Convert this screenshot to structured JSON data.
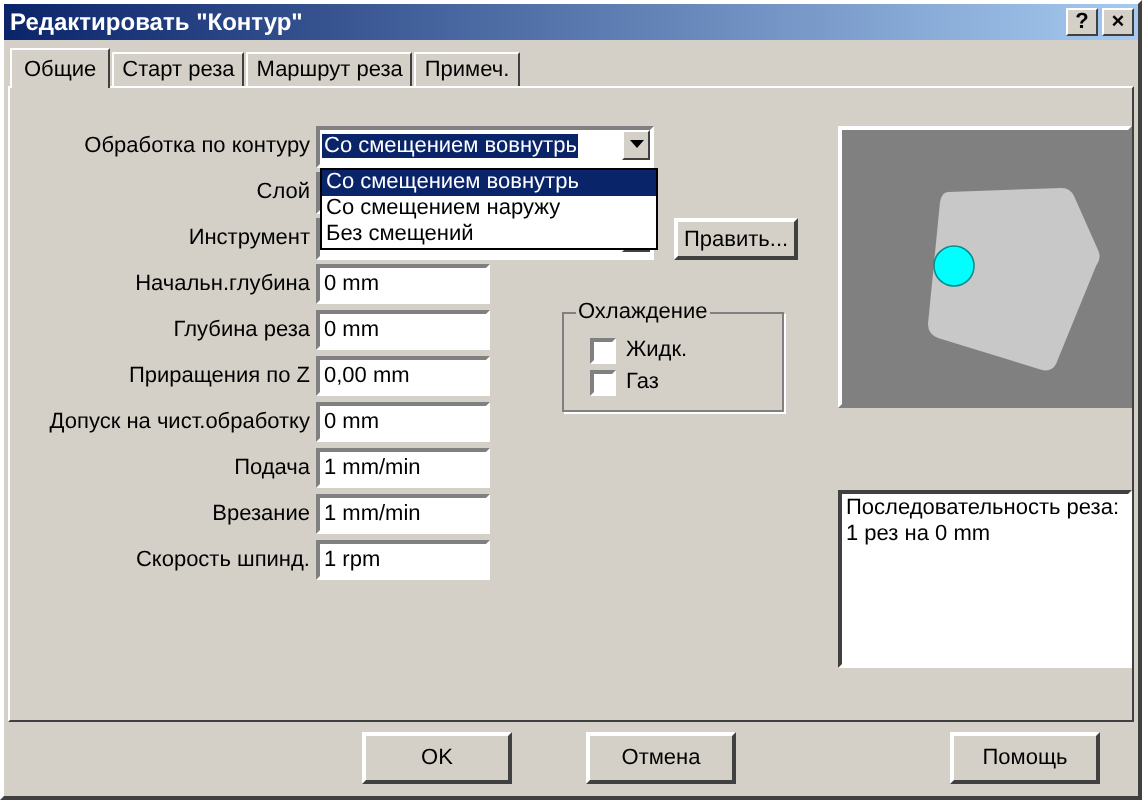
{
  "window": {
    "title": "Редактировать \"Контур\"",
    "title_buttons": [
      "?",
      "×"
    ]
  },
  "tabs": [
    {
      "label": "Общие",
      "selected": true
    },
    {
      "label": "Старт реза",
      "selected": false
    },
    {
      "label": "Маршрут реза",
      "selected": false
    },
    {
      "label": "Примеч.",
      "selected": false
    }
  ],
  "fields": [
    {
      "label": "Обработка по контуру",
      "kind": "combo",
      "value": "Со смещением вовнутрь",
      "options": [
        {
          "label": "Со смещением вовнутрь",
          "selected": true
        },
        {
          "label": "Со смещением наружу",
          "selected": false
        },
        {
          "label": "Без смещений",
          "selected": false
        }
      ]
    },
    {
      "label": "Слой",
      "kind": "combo"
    },
    {
      "label": "Инструмент",
      "kind": "combo"
    },
    {
      "label": "Начальн.глубина",
      "kind": "text",
      "value": "0 mm"
    },
    {
      "label": "Глубина реза",
      "kind": "text",
      "value": "0 mm"
    },
    {
      "label": "Приращения по Z",
      "kind": "text",
      "value": "0,00 mm"
    },
    {
      "label": "Допуск на чист.обработку",
      "kind": "text",
      "value": "0 mm"
    },
    {
      "label": "Подача",
      "kind": "text",
      "value": "1 mm/min"
    },
    {
      "label": "Врезание",
      "kind": "text",
      "value": "1 mm/min"
    },
    {
      "label": "Скорость шпинд.",
      "kind": "text",
      "value": "1 rpm"
    }
  ],
  "edit_button": "Править...",
  "cooling": {
    "title": "Охлаждение",
    "options": [
      {
        "label": "Жидк.",
        "checked": false
      },
      {
        "label": "Газ",
        "checked": false
      }
    ]
  },
  "summary": [
    "Последовательность реза:",
    "1 рез на 0 mm"
  ],
  "buttons": [
    "OK",
    "Отмена",
    "Помощь"
  ]
}
